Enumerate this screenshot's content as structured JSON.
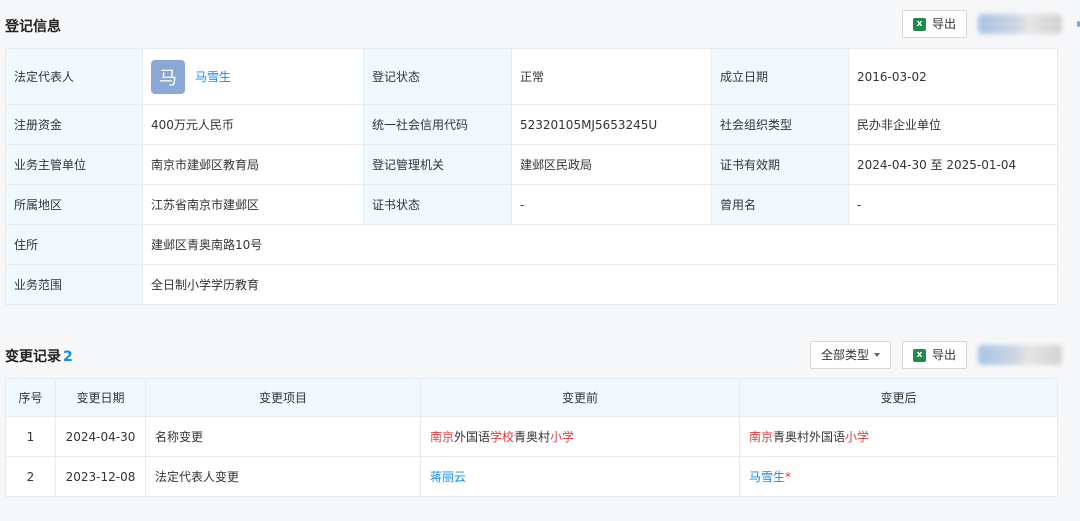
{
  "registration": {
    "title": "登记信息",
    "export_label": "导出",
    "fields": {
      "legal_rep_label": "法定代表人",
      "legal_rep_avatar": "马",
      "legal_rep_name": "马雪生",
      "reg_status_label": "登记状态",
      "reg_status_value": "正常",
      "found_date_label": "成立日期",
      "found_date_value": "2016-03-02",
      "capital_label": "注册资金",
      "capital_value": "400万元人民币",
      "credit_code_label": "统一社会信用代码",
      "credit_code_value": "52320105MJ5653245U",
      "org_type_label": "社会组织类型",
      "org_type_value": "民办非企业单位",
      "supervisor_label": "业务主管单位",
      "supervisor_value": "南京市建邺区教育局",
      "authority_label": "登记管理机关",
      "authority_value": "建邺区民政局",
      "cert_valid_label": "证书有效期",
      "cert_valid_value": "2024-04-30 至 2025-01-04",
      "region_label": "所属地区",
      "region_value": "江苏省南京市建邺区",
      "cert_status_label": "证书状态",
      "cert_status_value": "-",
      "former_name_label": "曾用名",
      "former_name_value": "-",
      "address_label": "住所",
      "address_value": "建邺区青奥南路10号",
      "scope_label": "业务范围",
      "scope_value": "全日制小学学历教育"
    }
  },
  "changes": {
    "title": "变更记录",
    "count": "2",
    "filter_label": "全部类型",
    "export_label": "导出",
    "headers": [
      "序号",
      "变更日期",
      "变更项目",
      "变更前",
      "变更后"
    ],
    "rows": [
      {
        "no": "1",
        "date": "2024-04-30",
        "item": "名称变更",
        "before": [
          {
            "t": "南京",
            "c": "red"
          },
          {
            "t": "外国语",
            "c": "plain"
          },
          {
            "t": "学校",
            "c": "red"
          },
          {
            "t": "青奥村",
            "c": "plain"
          },
          {
            "t": "小学",
            "c": "red"
          }
        ],
        "after": [
          {
            "t": "南京",
            "c": "red"
          },
          {
            "t": "青奥村外国语",
            "c": "plain"
          },
          {
            "t": "小学",
            "c": "red"
          }
        ]
      },
      {
        "no": "2",
        "date": "2023-12-08",
        "item": "法定代表人变更",
        "before": [
          {
            "t": "蒋丽云",
            "c": "link"
          }
        ],
        "after": [
          {
            "t": "马雪生",
            "c": "link"
          },
          {
            "t": "*",
            "c": "red"
          }
        ]
      }
    ]
  },
  "colors": {
    "accent": "#128bed",
    "highlight": "#e33a3a",
    "label_bg": "#f2f9fe",
    "excel_green": "#1f8a4c"
  }
}
